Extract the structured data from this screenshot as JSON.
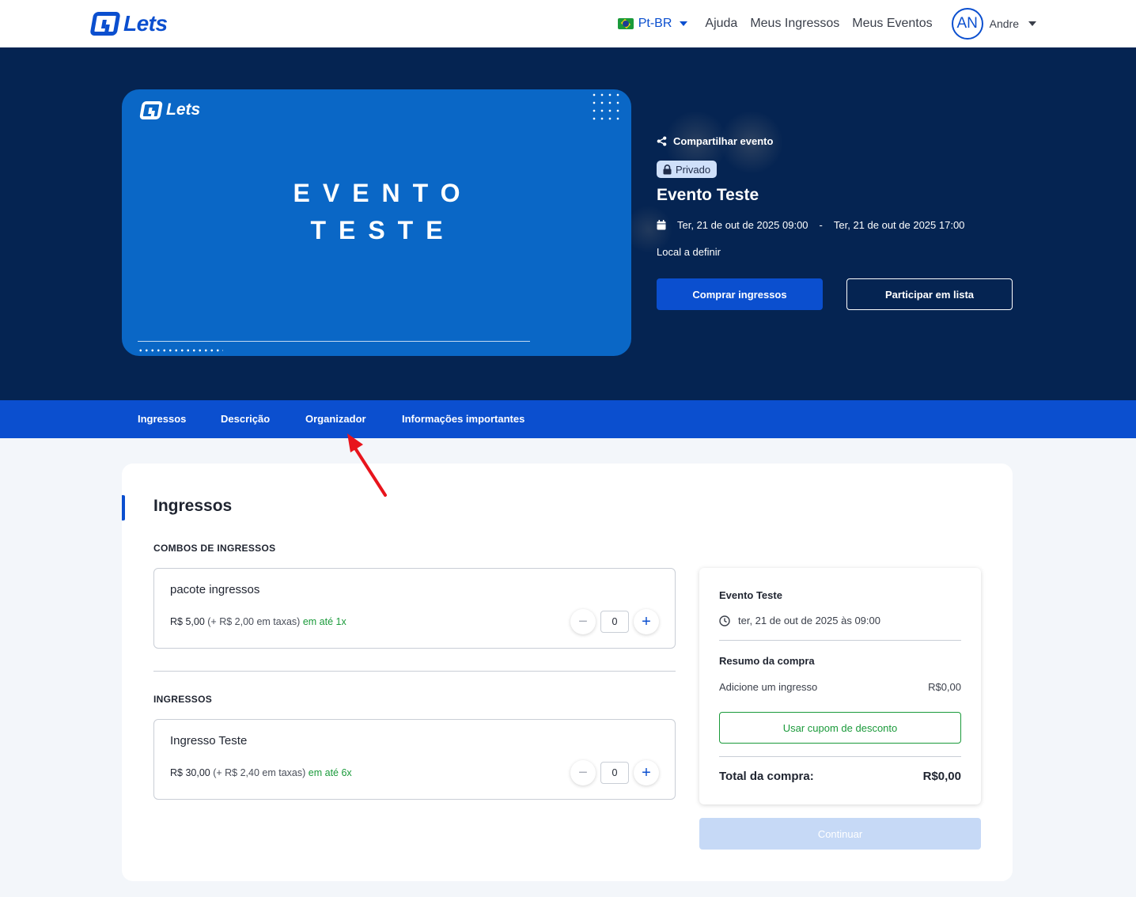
{
  "header": {
    "brand": "Lets",
    "language": "Pt-BR",
    "links": [
      "Ajuda",
      "Meus Ingressos",
      "Meus Eventos"
    ],
    "user_initials": "AN",
    "user_name": "Andre"
  },
  "hero": {
    "banner_brand": "Lets",
    "banner_title_line1": "EVENTO",
    "banner_title_line2": "TESTE",
    "share_label": "Compartilhar evento",
    "privacy_badge": "Privado",
    "event_title": "Evento Teste",
    "start_datetime": "Ter, 21 de out de 2025 09:00",
    "date_separator": "-",
    "end_datetime": "Ter, 21 de out de 2025 17:00",
    "location": "Local a definir",
    "buy_button": "Comprar ingressos",
    "list_button": "Participar em lista",
    "colors": {
      "background": "#052452",
      "banner": "#0a67c6",
      "accent": "#0b4fcf"
    }
  },
  "tabs": [
    "Ingressos",
    "Descrição",
    "Organizador",
    "Informações importantes"
  ],
  "annotation": {
    "type": "red-arrow",
    "target": "Organizador",
    "color": "#e8141c"
  },
  "tickets_section": {
    "title": "Ingressos",
    "combos_label": "COMBOS DE INGRESSOS",
    "combos": [
      {
        "name": "pacote ingressos",
        "price": "R$ 5,00",
        "fee": "(+ R$ 2,00 em taxas)",
        "installments": "em até 1x",
        "quantity": "0"
      }
    ],
    "tickets_label": "INGRESSOS",
    "tickets": [
      {
        "name": "Ingresso Teste",
        "price": "R$ 30,00",
        "fee": "(+ R$ 2,40 em taxas)",
        "installments": "em até 6x",
        "quantity": "0"
      }
    ],
    "stepper_minus": "−",
    "stepper_plus": "+"
  },
  "summary": {
    "event_name": "Evento Teste",
    "event_date": "ter, 21 de out de 2025 às 09:00",
    "heading": "Resumo da compra",
    "line_label": "Adicione um ingresso",
    "line_value": "R$0,00",
    "coupon_button": "Usar cupom de desconto",
    "total_label": "Total da compra:",
    "total_value": "R$0,00",
    "continue_button": "Continuar"
  }
}
